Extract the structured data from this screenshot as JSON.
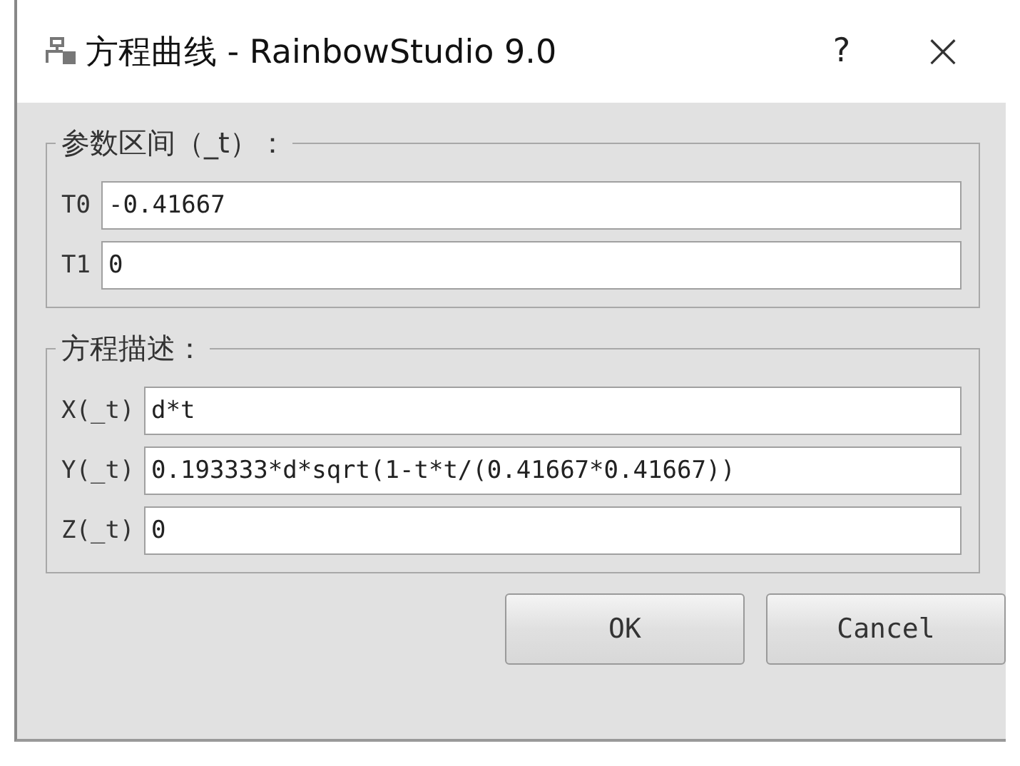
{
  "window": {
    "title": "方程曲线 - RainbowStudio 9.0",
    "help": "?",
    "close": "×"
  },
  "groups": [
    {
      "title": "参数区间（_t）：",
      "fields": [
        {
          "label": "T0",
          "value": "-0.41667"
        },
        {
          "label": "T1",
          "value": "0"
        }
      ]
    },
    {
      "title": "方程描述：",
      "fields": [
        {
          "label": "X(_t)",
          "value": "d*t"
        },
        {
          "label": "Y(_t)",
          "value": "0.193333*d*sqrt(1-t*t/(0.41667*0.41667))"
        },
        {
          "label": "Z(_t)",
          "value": "0"
        }
      ]
    }
  ],
  "buttons": [
    "OK",
    "Cancel"
  ]
}
